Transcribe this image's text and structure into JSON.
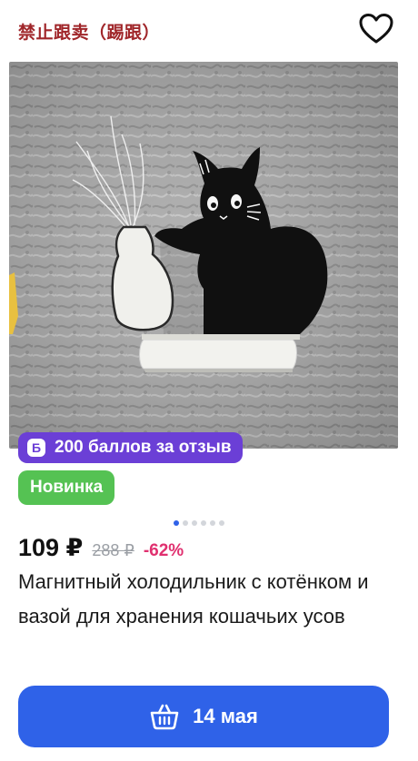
{
  "header": {
    "label": "禁止跟卖（踢跟）",
    "favorite_icon": "heart-icon"
  },
  "badges": {
    "points_icon_letter": "Б",
    "points": "200 баллов за отзыв",
    "new": "Новинка"
  },
  "gallery": {
    "total_images": 6,
    "current_index": 1
  },
  "price": {
    "current": "109 ₽",
    "old": "288 ₽",
    "discount": "-62%"
  },
  "product": {
    "title": "Магнитный холодильник с котёнком и вазой для хранения кошачьих усов"
  },
  "buy_button": {
    "icon": "basket-icon",
    "label": "14 мая"
  },
  "colors": {
    "accent_blue": "#2f62e8",
    "points_purple": "#6b3fd6",
    "new_green": "#55c253",
    "discount_pink": "#e0306f",
    "header_red": "#a0262a"
  }
}
